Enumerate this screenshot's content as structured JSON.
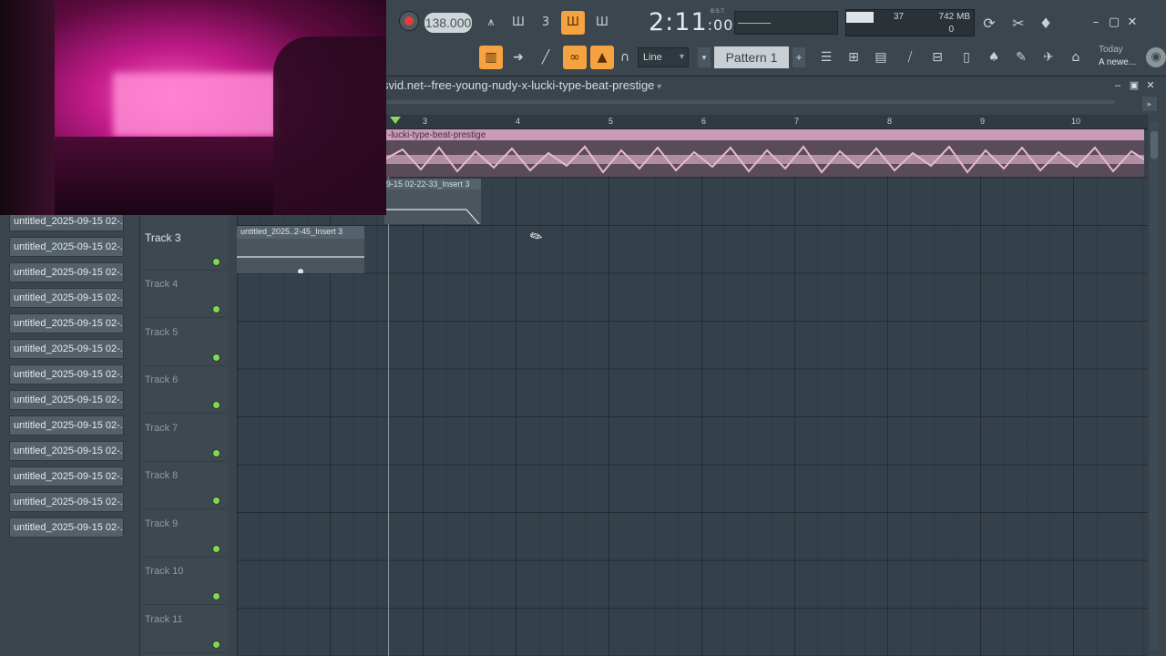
{
  "toolbar": {
    "tempo": "138.000",
    "time_main": "2:11",
    "time_sub": ":00",
    "time_unit": "B:S:T",
    "cpu_value": "37",
    "memory": "742 MB",
    "voices": "0",
    "snap_mode": "Line",
    "pattern_name": "Pattern 1",
    "hint_title": "Today",
    "hint_text": "A newe..."
  },
  "playlist": {
    "title": "svid.net--free-young-nudy-x-lucki-type-beat-prestige",
    "ruler_ticks": [
      "3",
      "4",
      "5",
      "6",
      "7",
      "8",
      "9",
      "10"
    ],
    "tracks": [
      "Track 3",
      "Track 4",
      "Track 5",
      "Track 6",
      "Track 7",
      "Track 8",
      "Track 9",
      "Track 10",
      "Track 11"
    ],
    "clips": {
      "audio_label": "-lucki-type-beat-prestige",
      "auto1_label": "9-15 02-22-33_Insert 3",
      "auto2_label": "untitled_2025..2-45_Insert 3"
    }
  },
  "browser": {
    "items": [
      "untitled_2025-09-15 02-...",
      "untitled_2025-09-15 02-...",
      "untitled_2025-09-15 02-...",
      "untitled_2025-09-15 02-...",
      "untitled_2025-09-15 02-...",
      "untitled_2025-09-15 02-...",
      "untitled_2025-09-15 02-...",
      "untitled_2025-09-15 02-...",
      "untitled_2025-09-15 02-...",
      "untitled_2025-09-15 02-...",
      "untitled_2025-09-15 02-...",
      "untitled_2025-09-15 02-...",
      "untitled_2025-09-15 02-..."
    ]
  },
  "colors": {
    "accent": "#f4a340",
    "audio_clip": "#c99bb6",
    "led": "#7ed957"
  }
}
